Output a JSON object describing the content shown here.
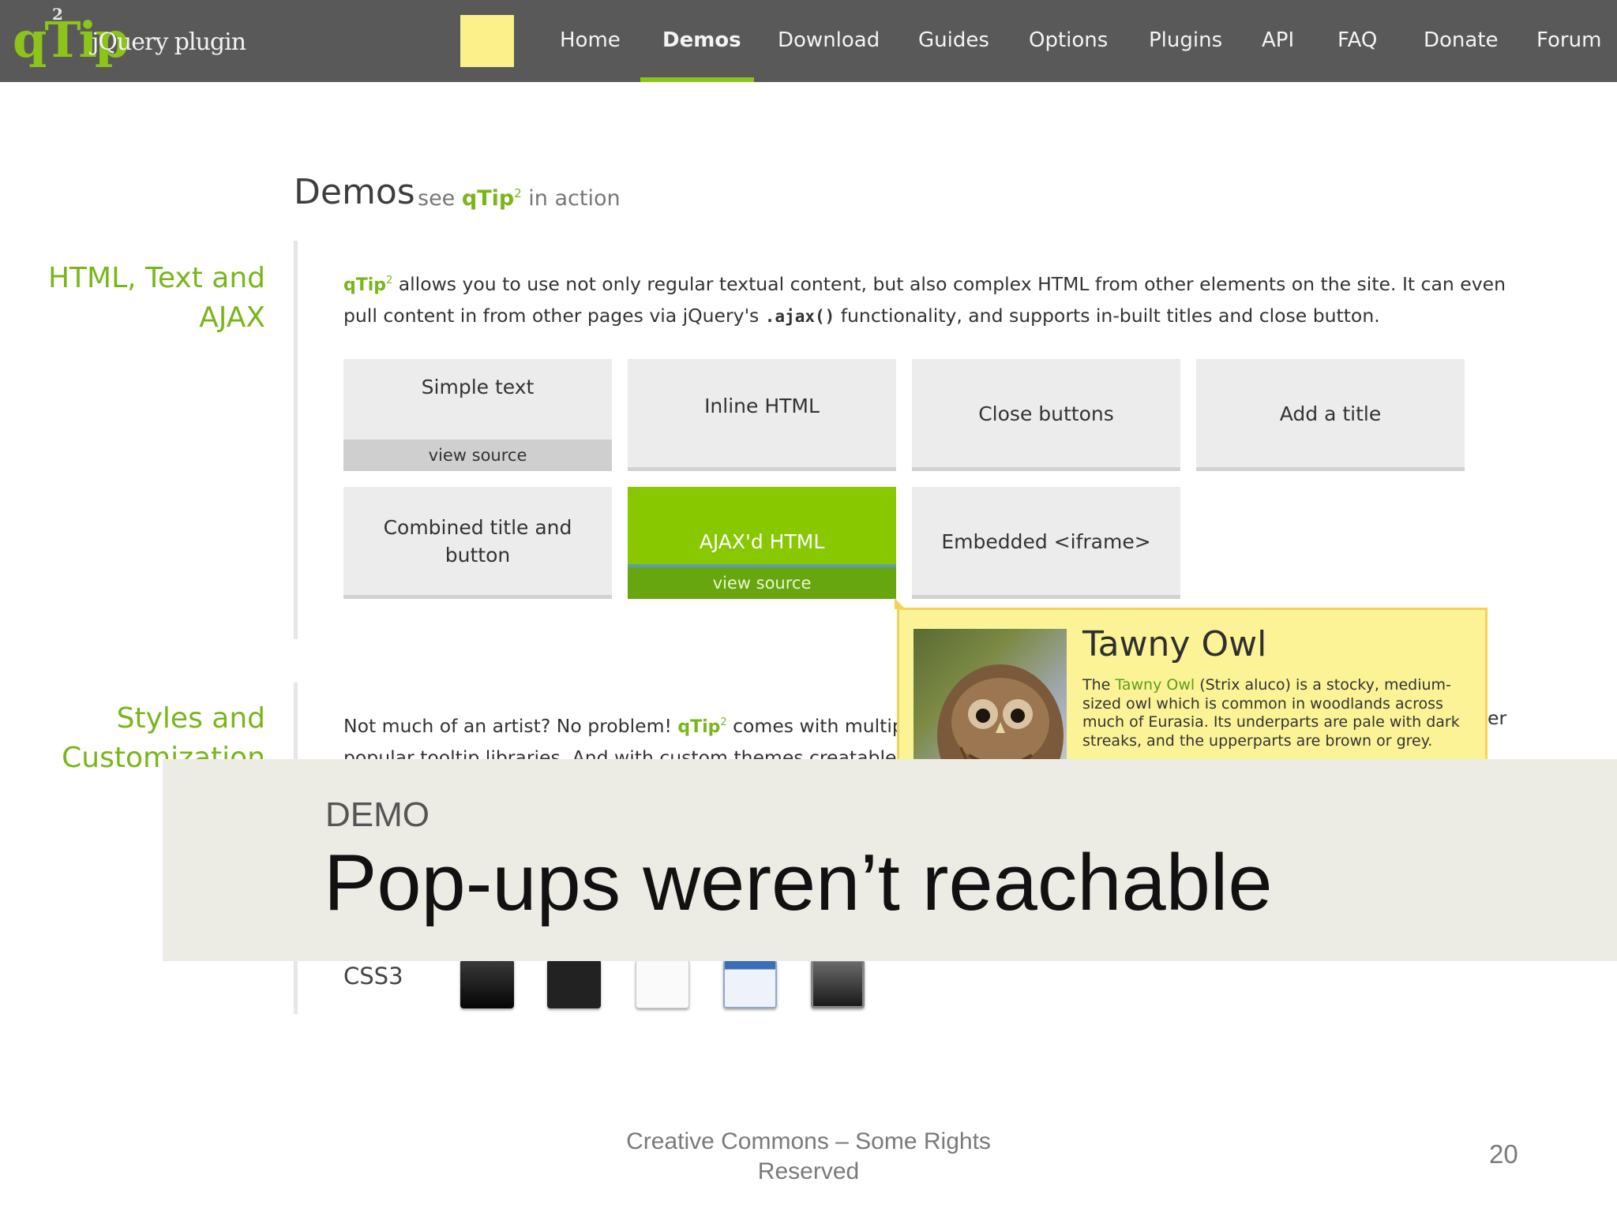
{
  "logo": {
    "letters": "qTip",
    "superscript": "2",
    "tagline": "jQuery plugin"
  },
  "nav": {
    "items": [
      {
        "label": "Home"
      },
      {
        "label": "Demos",
        "active": true
      },
      {
        "label": "Download"
      },
      {
        "label": "Guides"
      },
      {
        "label": "Options"
      },
      {
        "label": "Plugins"
      },
      {
        "label": "API"
      },
      {
        "label": "FAQ"
      },
      {
        "label": "Donate"
      },
      {
        "label": "Forum"
      }
    ]
  },
  "page": {
    "heading": "Demos",
    "sub_before": "see",
    "sub_brand": "qTip",
    "sub_after": "in action"
  },
  "section1": {
    "title_line1": "HTML, Text and",
    "title_line2": "AJAX",
    "para_brand": "qTip",
    "para_line1": "allows you to use not only regular textual content, but also complex HTML from other elements on the site. It can even",
    "para_line2_a": "pull content in from other pages via jQuery's",
    "para_code": ".ajax()",
    "para_line2_b": "functionality, and supports in-built titles and close button.",
    "tiles": [
      {
        "label": "Simple text",
        "view_source": "view source"
      },
      {
        "label": "Inline HTML"
      },
      {
        "label": "Close buttons"
      },
      {
        "label": "Add a title"
      },
      {
        "label_line1": "Combined title and",
        "label_line2": "button"
      },
      {
        "label": "AJAX'd HTML",
        "view_source": "view source",
        "active": true
      },
      {
        "label": "Embedded <iframe>"
      }
    ]
  },
  "tooltip": {
    "title": "Tawny Owl",
    "body_prefix": "The",
    "body_link": "Tawny Owl",
    "body_rest": "(Strix aluco) is a stocky, medium-sized owl which is common in woodlands across much of Eurasia. Its underparts are pale with dark streaks, and the upperparts are brown or grey."
  },
  "section2": {
    "title_line1": "Styles and",
    "title_line2": "Customization",
    "para_line1_a": "Not much of an artist? No problem!",
    "para_brand": "qTip",
    "para_line1_b": "comes with multip",
    "para_tail": "er",
    "para_line2": "popular tooltip libraries. And with custom themes creatable",
    "css3_label": "CSS3",
    "themes": [
      {
        "name": "dark",
        "color": "#1a1a1a"
      },
      {
        "name": "black",
        "color": "#222222"
      },
      {
        "name": "light",
        "color": "#f7f7f7"
      },
      {
        "name": "blue",
        "color": "#3a6fb6"
      },
      {
        "name": "gray",
        "color": "#3a3a3a"
      }
    ]
  },
  "banner": {
    "eyebrow": "DEMO",
    "title": "Pop-ups weren’t reachable"
  },
  "footer": {
    "line1": "Creative Commons – Some Rights",
    "line2": "Reserved",
    "page_number": "20"
  },
  "colors": {
    "accent": "#8cc41a",
    "nav_bg": "#595959",
    "tooltip_bg": "#fbf396",
    "banner_bg": "#ecebe4"
  }
}
